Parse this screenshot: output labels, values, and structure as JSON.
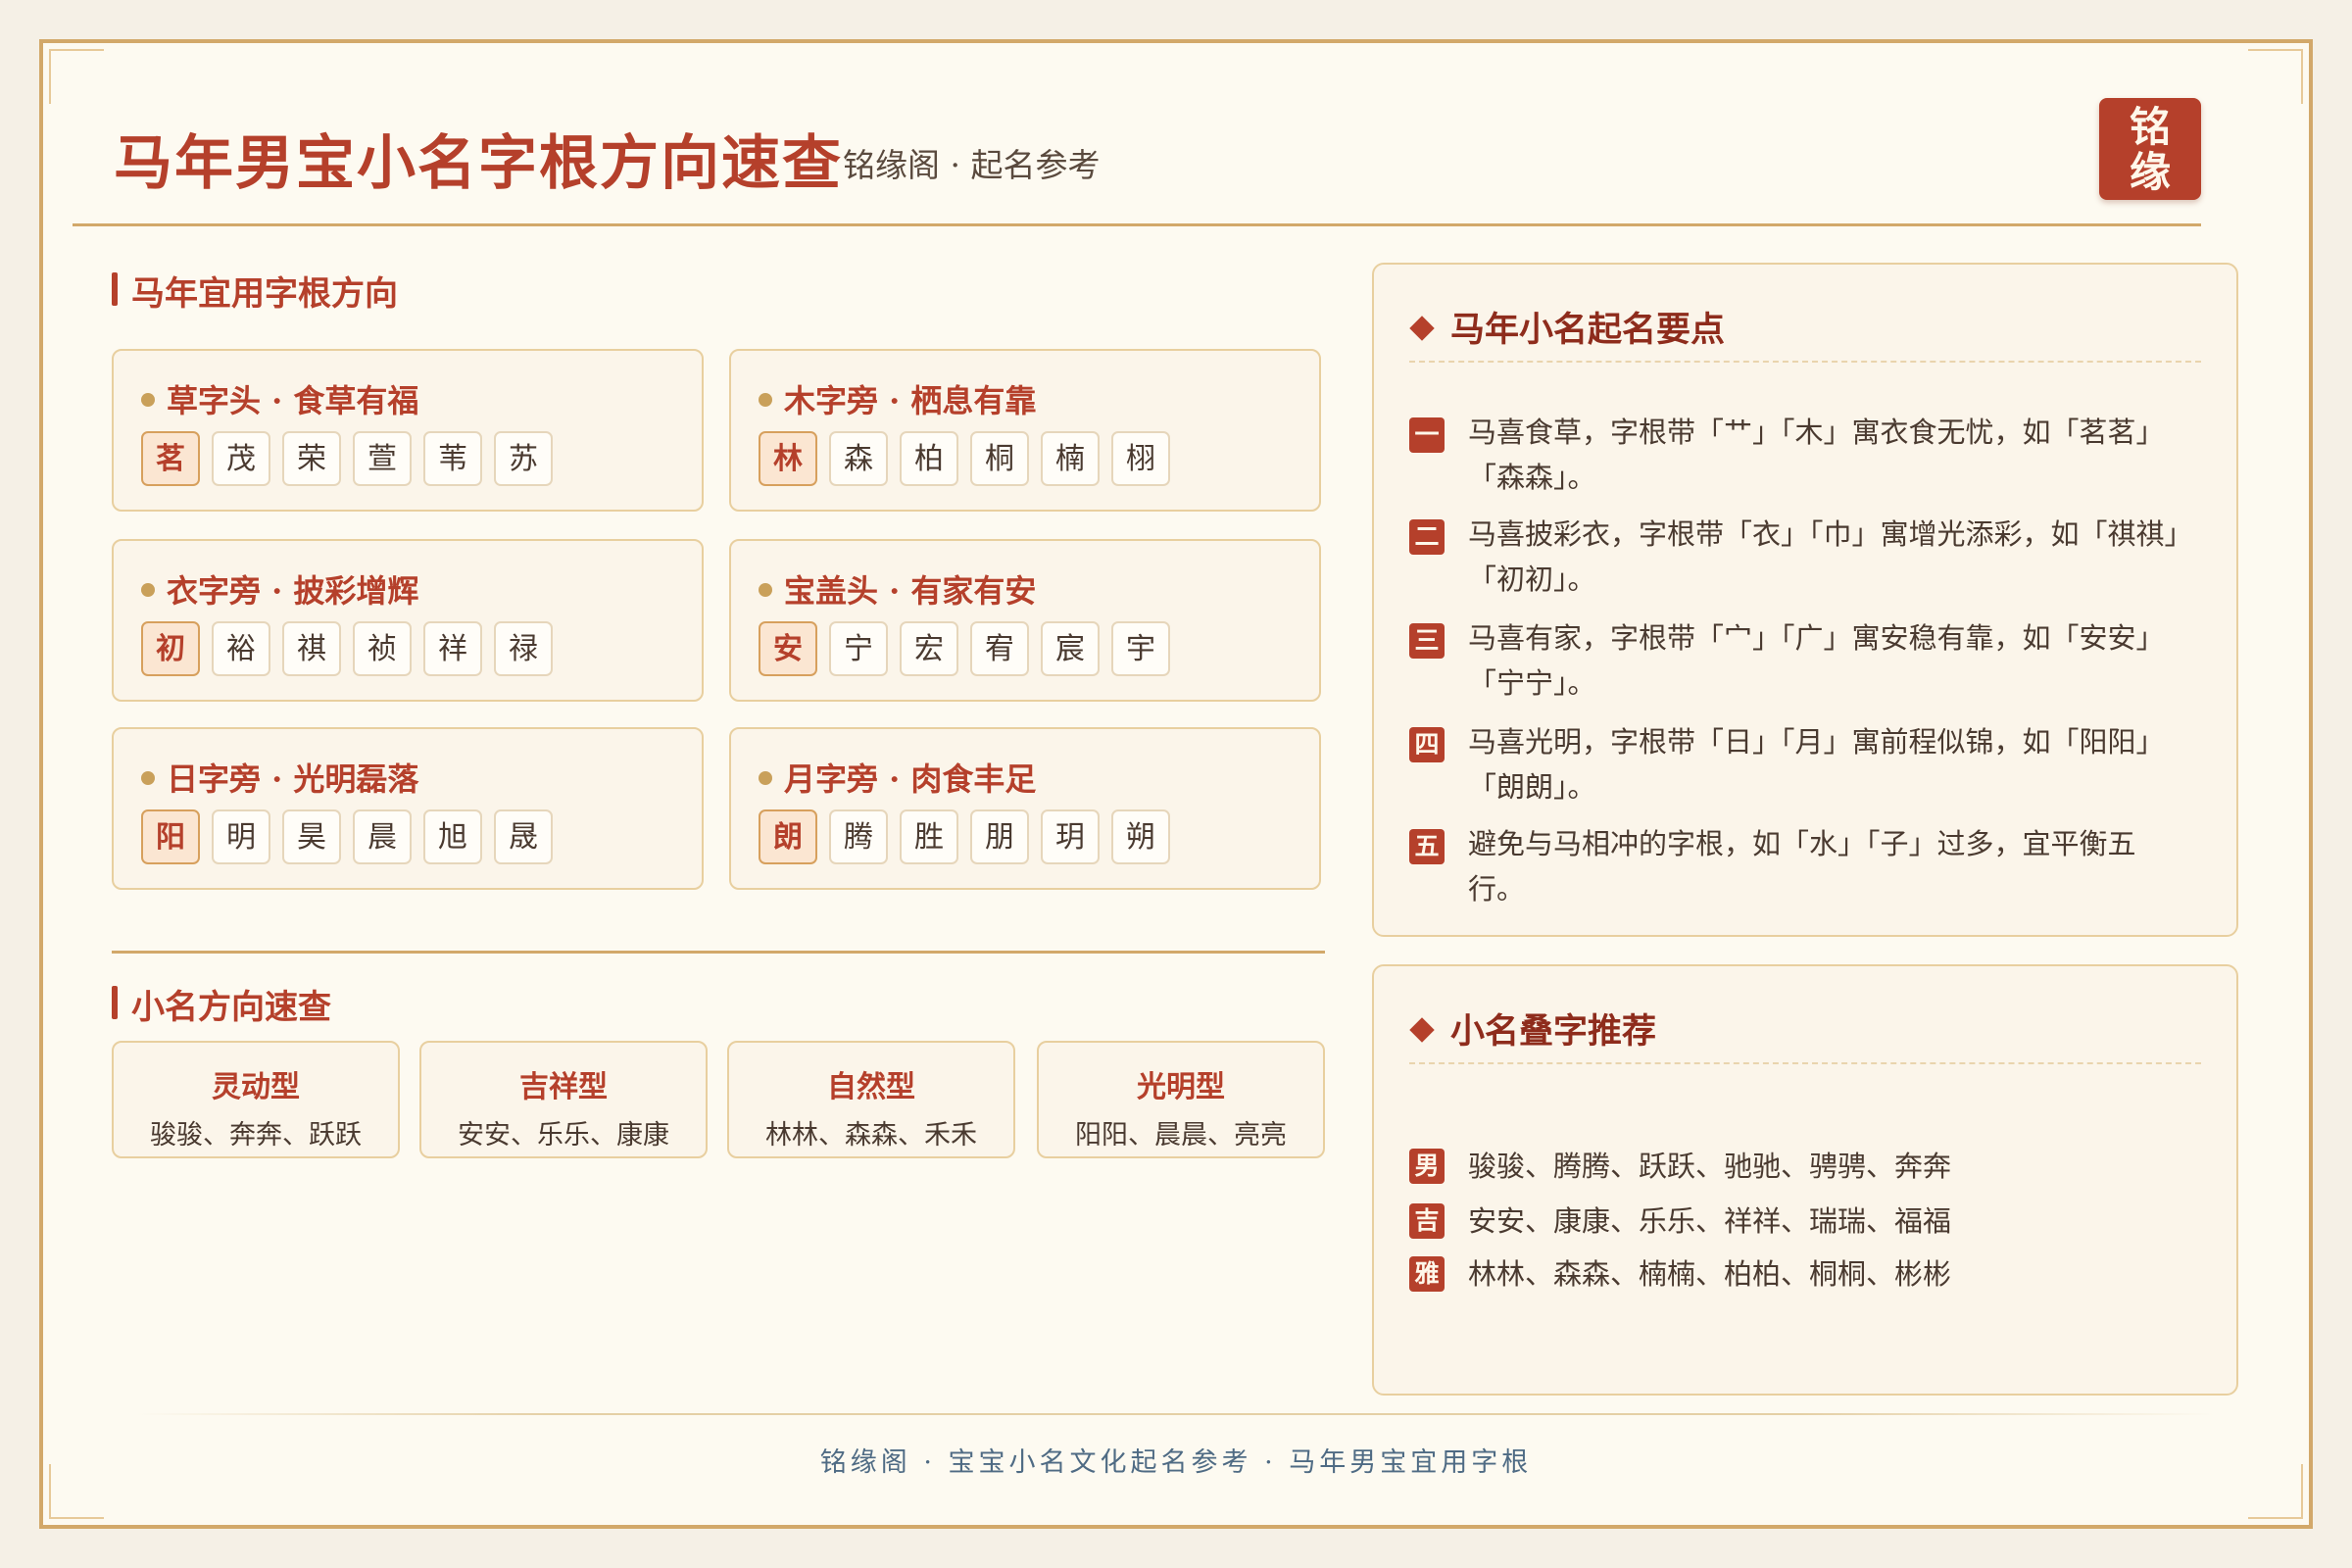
{
  "header": {
    "title": "马年男宝小名字根方向速查",
    "subtitle": "铭缘阁 · 起名参考",
    "seal": [
      "铭",
      "缘"
    ]
  },
  "radicals": {
    "heading": "马年宜用字根方向",
    "cards": [
      {
        "title": "草字头 · 食草有福",
        "chars": [
          "茗",
          "茂",
          "荣",
          "萱",
          "苇",
          "苏"
        ]
      },
      {
        "title": "木字旁 · 栖息有靠",
        "chars": [
          "林",
          "森",
          "柏",
          "桐",
          "楠",
          "栩"
        ]
      },
      {
        "title": "衣字旁 · 披彩增辉",
        "chars": [
          "初",
          "裕",
          "祺",
          "祯",
          "祥",
          "禄"
        ]
      },
      {
        "title": "宝盖头 · 有家有安",
        "chars": [
          "安",
          "宁",
          "宏",
          "宥",
          "宸",
          "宇"
        ]
      },
      {
        "title": "日字旁 · 光明磊落",
        "chars": [
          "阳",
          "明",
          "昊",
          "晨",
          "旭",
          "晟"
        ]
      },
      {
        "title": "月字旁 · 肉食丰足",
        "chars": [
          "朗",
          "腾",
          "胜",
          "朋",
          "玥",
          "朔"
        ]
      }
    ]
  },
  "types": {
    "heading": "小名方向速查",
    "items": [
      {
        "name": "灵动型",
        "examples": "骏骏、奔奔、跃跃"
      },
      {
        "name": "吉祥型",
        "examples": "安安、乐乐、康康"
      },
      {
        "name": "自然型",
        "examples": "林林、森森、禾禾"
      },
      {
        "name": "光明型",
        "examples": "阳阳、晨晨、亮亮"
      }
    ]
  },
  "tips": {
    "title": "马年小名起名要点",
    "items": [
      {
        "num": "一",
        "text": "马喜食草，字根带「艹」「木」寓衣食无忧，如「茗茗」「森森」。"
      },
      {
        "num": "二",
        "text": "马喜披彩衣，字根带「衣」「巾」寓增光添彩，如「祺祺」「初初」。"
      },
      {
        "num": "三",
        "text": "马喜有家，字根带「宀」「广」寓安稳有靠，如「安安」「宁宁」。"
      },
      {
        "num": "四",
        "text": "马喜光明，字根带「日」「月」寓前程似锦，如「阳阳」「朗朗」。"
      },
      {
        "num": "五",
        "text": "避免与马相冲的字根，如「水」「子」过多，宜平衡五行。"
      }
    ]
  },
  "recommend": {
    "title": "小名叠字推荐",
    "items": [
      {
        "tag": "男",
        "text": "骏骏、腾腾、跃跃、驰驰、骋骋、奔奔"
      },
      {
        "tag": "吉",
        "text": "安安、康康、乐乐、祥祥、瑞瑞、福福"
      },
      {
        "tag": "雅",
        "text": "林林、森森、楠楠、柏柏、桐桐、彬彬"
      }
    ]
  },
  "footer": "铭缘阁 · 宝宝小名文化起名参考 · 马年男宝宜用字根",
  "colors": {
    "accent": "#b5402b",
    "gold": "#d2a86a",
    "background": "#fdfaf1"
  }
}
